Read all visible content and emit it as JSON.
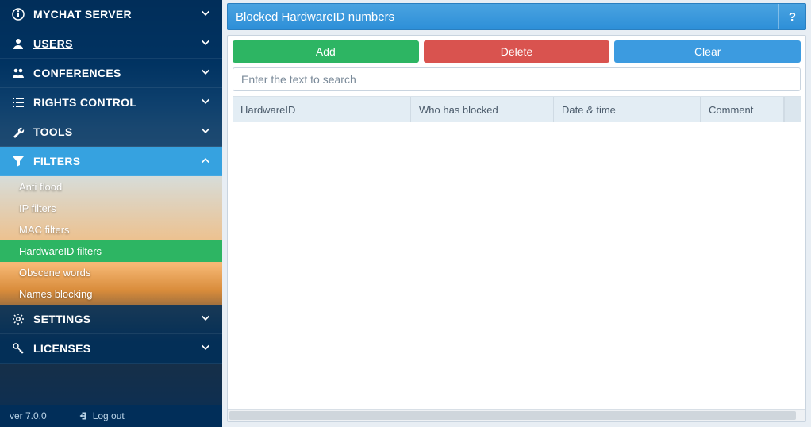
{
  "sidebar": {
    "items": [
      {
        "label": "MYCHAT SERVER",
        "icon": "info-icon"
      },
      {
        "label": "USERS",
        "icon": "user-icon",
        "underline": true
      },
      {
        "label": "CONFERENCES",
        "icon": "group-icon"
      },
      {
        "label": "RIGHTS CONTROL",
        "icon": "list-icon"
      },
      {
        "label": "TOOLS",
        "icon": "wrench-icon"
      },
      {
        "label": "FILTERS",
        "icon": "funnel-icon",
        "active": true
      },
      {
        "label": "SETTINGS",
        "icon": "gears-icon"
      },
      {
        "label": "LICENSES",
        "icon": "key-icon"
      }
    ],
    "filters_subitems": [
      {
        "label": "Anti flood"
      },
      {
        "label": "IP filters"
      },
      {
        "label": "MAC filters"
      },
      {
        "label": "HardwareID filters",
        "active": true
      },
      {
        "label": "Obscene words"
      },
      {
        "label": "Names blocking"
      }
    ]
  },
  "footer": {
    "version": "ver 7.0.0",
    "logout": "Log out"
  },
  "main": {
    "title": "Blocked HardwareID numbers",
    "help": "?",
    "buttons": {
      "add": "Add",
      "delete": "Delete",
      "clear": "Clear"
    },
    "search_placeholder": "Enter the text to search",
    "columns": {
      "hardware_id": "HardwareID",
      "who": "Who has blocked",
      "datetime": "Date & time",
      "comment": "Comment"
    },
    "rows": []
  }
}
